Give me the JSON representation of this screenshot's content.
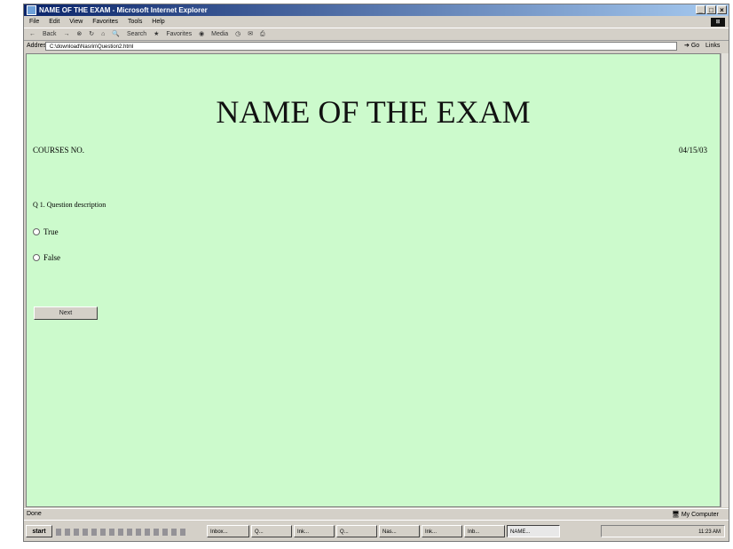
{
  "window": {
    "title": "NAME OF THE EXAM - Microsoft Internet Explorer",
    "controls": [
      "_",
      "□",
      "×"
    ]
  },
  "menu": [
    "File",
    "Edit",
    "View",
    "Favorites",
    "Tools",
    "Help"
  ],
  "toolbar": {
    "back": "Back",
    "search": "Search",
    "favorites": "Favorites",
    "media": "Media"
  },
  "address": {
    "label": "Address",
    "value": "C:\\download\\Nasrin\\Question2.html",
    "go": "Go",
    "links": "Links"
  },
  "page": {
    "exam_title": "NAME OF THE EXAM",
    "course": "COURSES NO.",
    "date": "04/15/03",
    "question": "Q 1.  Question description",
    "options": [
      "True",
      "False"
    ],
    "next_button": "Next"
  },
  "status": {
    "text": "Done",
    "zone": "My Computer"
  },
  "taskbar": {
    "start": "start",
    "tasks": [
      "Inbox...",
      "Q...",
      "Ink...",
      "Q...",
      "Nas...",
      "Ink...",
      "Inb...",
      "NAME..."
    ],
    "clock": "11:23 AM"
  }
}
